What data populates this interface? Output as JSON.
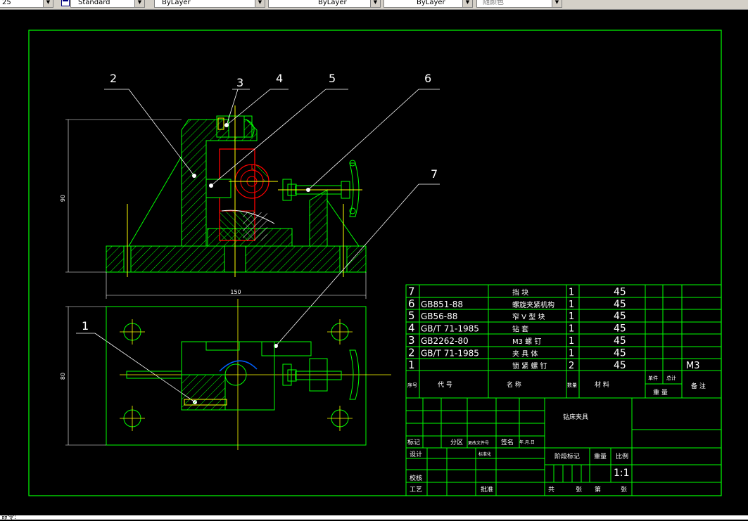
{
  "toolbar": {
    "scale_value": "25",
    "text_style": "Standard",
    "layer_linetype": "ByLayer",
    "linetype": "ByLayer",
    "lineweight": "ByLayer",
    "plot_color": "随颜色"
  },
  "drawing": {
    "balloons": [
      "2",
      "3",
      "4",
      "5",
      "6",
      "7",
      "1"
    ],
    "dim_height_front": "90",
    "dim_width_front": "150",
    "dim_height_top": "80"
  },
  "parts_list": [
    {
      "no": "7",
      "code": "",
      "name": "挡 块",
      "qty": "1",
      "material": "45",
      "remark": ""
    },
    {
      "no": "6",
      "code": "GB851-88",
      "name": "螺旋夹紧机构",
      "qty": "1",
      "material": "45",
      "remark": ""
    },
    {
      "no": "5",
      "code": "GB56-88",
      "name": "窄 V 型 块",
      "qty": "1",
      "material": "45",
      "remark": ""
    },
    {
      "no": "4",
      "code": "GB/T 71-1985",
      "name": "钻 套",
      "qty": "1",
      "material": "45",
      "remark": ""
    },
    {
      "no": "3",
      "code": "GB2262-80",
      "name": "M3 螺 钉",
      "qty": "1",
      "material": "45",
      "remark": ""
    },
    {
      "no": "2",
      "code": "GB/T 71-1985",
      "name": "夹 具 体",
      "qty": "1",
      "material": "45",
      "remark": ""
    },
    {
      "no": "1",
      "code": "",
      "name": "锁 紧 螺 钉",
      "qty": "2",
      "material": "45",
      "remark": "M3"
    }
  ],
  "parts_header": {
    "no": "序号",
    "code": "代 号",
    "name": "名 称",
    "qty": "数量",
    "material": "材 料",
    "unit_weight": "单件",
    "total_weight": "总计",
    "weight": "重 量",
    "remark": "备 注"
  },
  "title_block": {
    "title": "钻床夹具",
    "mark": "标记",
    "zone": "分区",
    "change_doc": "更改文件号",
    "sign": "签名",
    "date": "年.月.日",
    "design": "设计",
    "standardize": "标准化",
    "check": "校核",
    "process": "工艺",
    "approve": "批准",
    "stage_mark": "阶段标记",
    "weight": "重量",
    "scale": "比例",
    "scale_value": "1:1",
    "sheets_total": "共",
    "sheet_unit": "张",
    "sheet_no": "第",
    "sheet_unit2": "张"
  },
  "colors": {
    "border": "#00ff00",
    "outline": "#00ff00",
    "centerline": "#ffff00",
    "section_part": "#ff0000",
    "white": "#ffffff",
    "dim": "#ffffff"
  },
  "command_line": "命令:"
}
